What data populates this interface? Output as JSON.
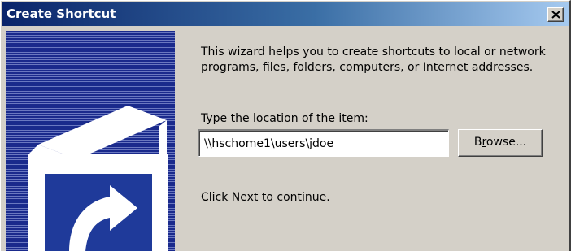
{
  "window": {
    "title": "Create Shortcut"
  },
  "title_bar": {
    "close_icon": "close-icon"
  },
  "side_panel": {
    "icon": "shortcut-arrow-icon"
  },
  "content": {
    "intro": "This wizard helps you to create shortcuts to local or network programs, files, folders, computers, or Internet addresses.",
    "location_label": {
      "mnemonic": "T",
      "rest": "ype the location of the item:"
    },
    "location_value": "\\\\hschome1\\users\\jdoe",
    "browse_button": {
      "before": "B",
      "mnemonic": "r",
      "after": "owse..."
    },
    "continue_text": "Click Next to continue."
  },
  "colors": {
    "title_bar_start": "#0a246a",
    "title_bar_end": "#a6caf0",
    "dialog_background": "#d4d0c8",
    "side_panel": "#1a2a8c"
  }
}
